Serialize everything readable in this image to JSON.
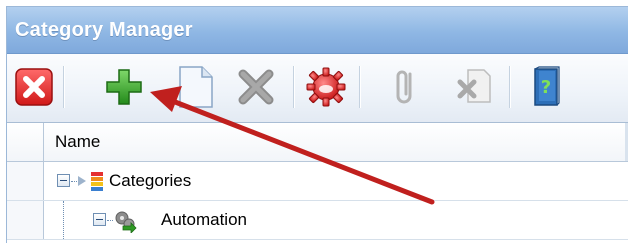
{
  "window": {
    "title": "Category Manager"
  },
  "toolbar": {
    "buttons": [
      {
        "name": "close-button",
        "icon": "red-x-icon"
      },
      {
        "name": "add-button",
        "icon": "green-plus-icon"
      },
      {
        "name": "new-document-button",
        "icon": "blank-document-icon"
      },
      {
        "name": "delete-button",
        "icon": "gray-x-icon"
      },
      {
        "name": "settings-button",
        "icon": "red-gear-icon"
      },
      {
        "name": "attach-button",
        "icon": "paperclip-icon"
      },
      {
        "name": "remove-attachment-button",
        "icon": "document-x-icon"
      },
      {
        "name": "help-button",
        "icon": "help-book-icon"
      }
    ]
  },
  "grid": {
    "columns": [
      {
        "label": "Name"
      }
    ],
    "rows": [
      {
        "label": "Categories",
        "icon": "categories-icon",
        "expanded": true
      },
      {
        "label": "Automation",
        "icon": "automation-gears-icon",
        "expanded": true
      }
    ]
  },
  "annotation": {
    "color": "#c0201e",
    "points_to": "add-button"
  },
  "colors": {
    "title_bg": "#8fb7e4",
    "title_text": "#ffffff",
    "accent_red": "#e53030",
    "accent_green": "#2f9a25"
  }
}
